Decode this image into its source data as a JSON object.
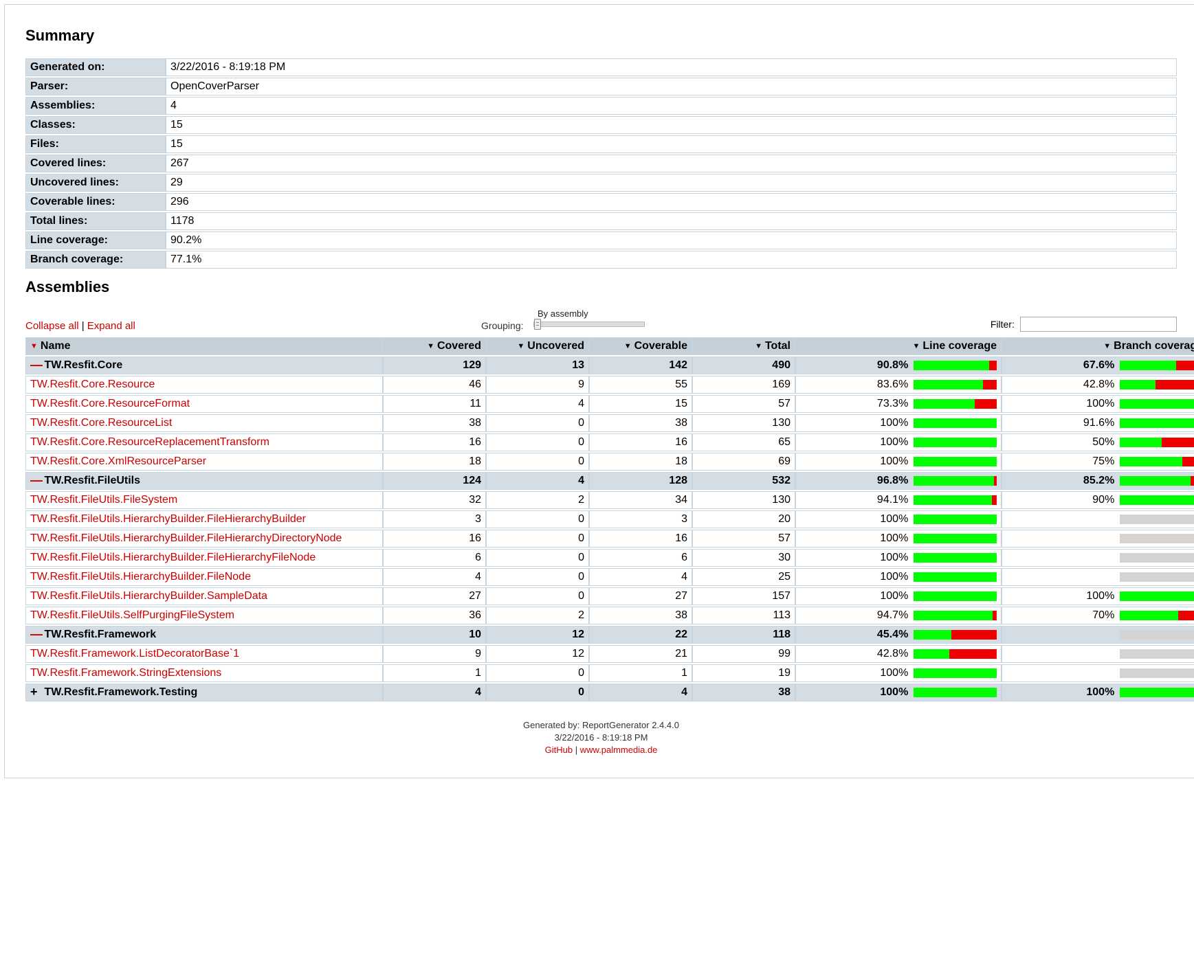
{
  "headings": {
    "summary": "Summary",
    "assemblies": "Assemblies"
  },
  "summary": [
    {
      "label": "Generated on:",
      "value": "3/22/2016 - 8:19:18 PM"
    },
    {
      "label": "Parser:",
      "value": "OpenCoverParser"
    },
    {
      "label": "Assemblies:",
      "value": "4"
    },
    {
      "label": "Classes:",
      "value": "15"
    },
    {
      "label": "Files:",
      "value": "15"
    },
    {
      "label": "Covered lines:",
      "value": "267"
    },
    {
      "label": "Uncovered lines:",
      "value": "29"
    },
    {
      "label": "Coverable lines:",
      "value": "296"
    },
    {
      "label": "Total lines:",
      "value": "1178"
    },
    {
      "label": "Line coverage:",
      "value": "90.2%"
    },
    {
      "label": "Branch coverage:",
      "value": "77.1%"
    }
  ],
  "toolbar": {
    "collapse": "Collapse all",
    "expand": "Expand all",
    "grouping_label": "Grouping:",
    "by_assembly": "By assembly",
    "filter_label": "Filter:"
  },
  "columns": {
    "name": "Name",
    "covered": "Covered",
    "uncovered": "Uncovered",
    "coverable": "Coverable",
    "total": "Total",
    "line_coverage": "Line coverage",
    "branch_coverage": "Branch coverage"
  },
  "rows": [
    {
      "type": "group",
      "expanded": true,
      "name": "TW.Resfit.Core",
      "covered": 129,
      "uncovered": 13,
      "coverable": 142,
      "total": 490,
      "line_pct": "90.8%",
      "line_green": 90.8,
      "line_red": 9.2,
      "branch_pct": "67.6%",
      "branch_green": 67.6,
      "branch_red": 32.4
    },
    {
      "type": "class",
      "name": "TW.Resfit.Core.Resource",
      "covered": 46,
      "uncovered": 9,
      "coverable": 55,
      "total": 169,
      "line_pct": "83.6%",
      "line_green": 83.6,
      "line_red": 16.4,
      "branch_pct": "42.8%",
      "branch_green": 42.8,
      "branch_red": 57.2
    },
    {
      "type": "class",
      "name": "TW.Resfit.Core.ResourceFormat",
      "covered": 11,
      "uncovered": 4,
      "coverable": 15,
      "total": 57,
      "line_pct": "73.3%",
      "line_green": 73.3,
      "line_red": 26.7,
      "branch_pct": "100%",
      "branch_green": 100,
      "branch_red": 0
    },
    {
      "type": "class",
      "name": "TW.Resfit.Core.ResourceList",
      "covered": 38,
      "uncovered": 0,
      "coverable": 38,
      "total": 130,
      "line_pct": "100%",
      "line_green": 100,
      "line_red": 0,
      "branch_pct": "91.6%",
      "branch_green": 91.6,
      "branch_red": 8.4
    },
    {
      "type": "class",
      "name": "TW.Resfit.Core.ResourceReplacementTransform",
      "covered": 16,
      "uncovered": 0,
      "coverable": 16,
      "total": 65,
      "line_pct": "100%",
      "line_green": 100,
      "line_red": 0,
      "branch_pct": "50%",
      "branch_green": 50,
      "branch_red": 50
    },
    {
      "type": "class",
      "name": "TW.Resfit.Core.XmlResourceParser",
      "covered": 18,
      "uncovered": 0,
      "coverable": 18,
      "total": 69,
      "line_pct": "100%",
      "line_green": 100,
      "line_red": 0,
      "branch_pct": "75%",
      "branch_green": 75,
      "branch_red": 25
    },
    {
      "type": "group",
      "expanded": true,
      "name": "TW.Resfit.FileUtils",
      "covered": 124,
      "uncovered": 4,
      "coverable": 128,
      "total": 532,
      "line_pct": "96.8%",
      "line_green": 96.8,
      "line_red": 3.2,
      "branch_pct": "85.2%",
      "branch_green": 85.2,
      "branch_red": 14.8
    },
    {
      "type": "class",
      "name": "TW.Resfit.FileUtils.FileSystem",
      "covered": 32,
      "uncovered": 2,
      "coverable": 34,
      "total": 130,
      "line_pct": "94.1%",
      "line_green": 94.1,
      "line_red": 5.9,
      "branch_pct": "90%",
      "branch_green": 90,
      "branch_red": 10
    },
    {
      "type": "class",
      "name": "TW.Resfit.FileUtils.HierarchyBuilder.FileHierarchyBuilder",
      "covered": 3,
      "uncovered": 0,
      "coverable": 3,
      "total": 20,
      "line_pct": "100%",
      "line_green": 100,
      "line_red": 0,
      "branch_pct": "",
      "branch_gray": true
    },
    {
      "type": "class",
      "name": "TW.Resfit.FileUtils.HierarchyBuilder.FileHierarchyDirectoryNode",
      "covered": 16,
      "uncovered": 0,
      "coverable": 16,
      "total": 57,
      "line_pct": "100%",
      "line_green": 100,
      "line_red": 0,
      "branch_pct": "",
      "branch_gray": true
    },
    {
      "type": "class",
      "name": "TW.Resfit.FileUtils.HierarchyBuilder.FileHierarchyFileNode",
      "covered": 6,
      "uncovered": 0,
      "coverable": 6,
      "total": 30,
      "line_pct": "100%",
      "line_green": 100,
      "line_red": 0,
      "branch_pct": "",
      "branch_gray": true
    },
    {
      "type": "class",
      "name": "TW.Resfit.FileUtils.HierarchyBuilder.FileNode",
      "covered": 4,
      "uncovered": 0,
      "coverable": 4,
      "total": 25,
      "line_pct": "100%",
      "line_green": 100,
      "line_red": 0,
      "branch_pct": "",
      "branch_gray": true
    },
    {
      "type": "class",
      "name": "TW.Resfit.FileUtils.HierarchyBuilder.SampleData",
      "covered": 27,
      "uncovered": 0,
      "coverable": 27,
      "total": 157,
      "line_pct": "100%",
      "line_green": 100,
      "line_red": 0,
      "branch_pct": "100%",
      "branch_green": 100,
      "branch_red": 0
    },
    {
      "type": "class",
      "name": "TW.Resfit.FileUtils.SelfPurgingFileSystem",
      "covered": 36,
      "uncovered": 2,
      "coverable": 38,
      "total": 113,
      "line_pct": "94.7%",
      "line_green": 94.7,
      "line_red": 5.3,
      "branch_pct": "70%",
      "branch_green": 70,
      "branch_red": 30
    },
    {
      "type": "group",
      "expanded": true,
      "name": "TW.Resfit.Framework",
      "covered": 10,
      "uncovered": 12,
      "coverable": 22,
      "total": 118,
      "line_pct": "45.4%",
      "line_green": 45.4,
      "line_red": 54.6,
      "branch_pct": "",
      "branch_gray": true
    },
    {
      "type": "class",
      "name": "TW.Resfit.Framework.ListDecoratorBase`1",
      "covered": 9,
      "uncovered": 12,
      "coverable": 21,
      "total": 99,
      "line_pct": "42.8%",
      "line_green": 42.8,
      "line_red": 57.2,
      "branch_pct": "",
      "branch_gray": true
    },
    {
      "type": "class",
      "name": "TW.Resfit.Framework.StringExtensions",
      "covered": 1,
      "uncovered": 0,
      "coverable": 1,
      "total": 19,
      "line_pct": "100%",
      "line_green": 100,
      "line_red": 0,
      "branch_pct": "",
      "branch_gray": true
    },
    {
      "type": "group",
      "expanded": false,
      "name": "TW.Resfit.Framework.Testing",
      "covered": 4,
      "uncovered": 0,
      "coverable": 4,
      "total": 38,
      "line_pct": "100%",
      "line_green": 100,
      "line_red": 0,
      "branch_pct": "100%",
      "branch_green": 100,
      "branch_red": 0
    }
  ],
  "footer": {
    "line1": "Generated by: ReportGenerator 2.4.4.0",
    "line2": "3/22/2016 - 8:19:18 PM",
    "github": "GitHub",
    "site": "www.palmmedia.de"
  }
}
